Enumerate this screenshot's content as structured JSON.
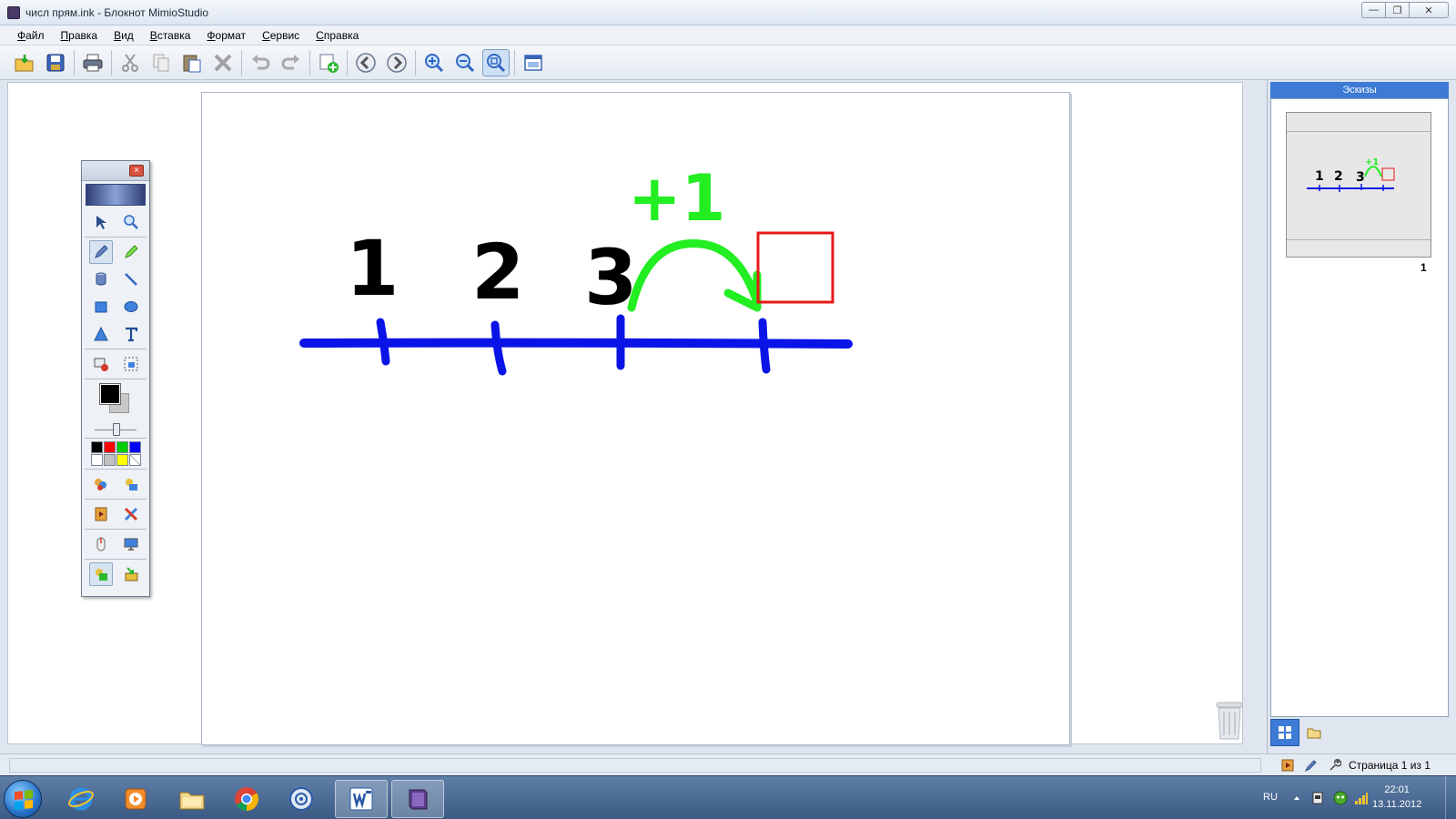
{
  "window": {
    "title": "числ прям.ink - Блокнот MimioStudio",
    "minimize": "—",
    "maximize": "❐",
    "close": "✕"
  },
  "menu": [
    {
      "label": "Файл"
    },
    {
      "label": "Правка"
    },
    {
      "label": "Вид"
    },
    {
      "label": "Вставка"
    },
    {
      "label": "Формат"
    },
    {
      "label": "Сервис"
    },
    {
      "label": "Справка"
    }
  ],
  "toolbar": {
    "icons": [
      "open-icon",
      "save-icon",
      "print-icon",
      "cut-icon",
      "copy-icon",
      "paste-icon",
      "delete-icon",
      "undo-icon",
      "redo-icon",
      "new-page-icon",
      "previous-page-icon",
      "next-page-icon",
      "zoom-in-icon",
      "zoom-out-icon",
      "fit-page-icon",
      "display-settings-icon"
    ],
    "active": "fit-page-icon"
  },
  "canvas": {
    "numbers": [
      "1",
      "2",
      "3"
    ],
    "jump_label": "+1",
    "colors": {
      "numbers": "#000000",
      "line": "#0a14e6",
      "jump": "#22ee22",
      "box": "#e81818"
    }
  },
  "palette": {
    "close": "×",
    "tools": [
      "select-arrow-icon",
      "zoom-tool-icon",
      "pen-icon",
      "highlighter-icon",
      "fill-bucket-icon",
      "line-tool-icon",
      "rectangle-tool-icon",
      "ellipse-tool-icon",
      "triangle-tool-icon",
      "text-tool-icon",
      "screen-capture-icon",
      "area-capture-icon"
    ],
    "active_tool": "pen-icon",
    "foreground_color": "#000000",
    "background_color": "#c8c8c8",
    "colors": [
      "#000000",
      "#ff0000",
      "#00cc00",
      "#0000ff",
      "#ffffff",
      "#c0c0c0",
      "#ffff00",
      "transparent"
    ]
  },
  "thumbnails": {
    "title": "Эскизы",
    "page_number": "1",
    "numbers": [
      "1",
      "2",
      "3"
    ],
    "jump_label": "+1"
  },
  "status": {
    "page": "Страница 1 из 1"
  },
  "tray": {
    "language": "RU",
    "time": "22:01",
    "date": "13.11.2012"
  }
}
